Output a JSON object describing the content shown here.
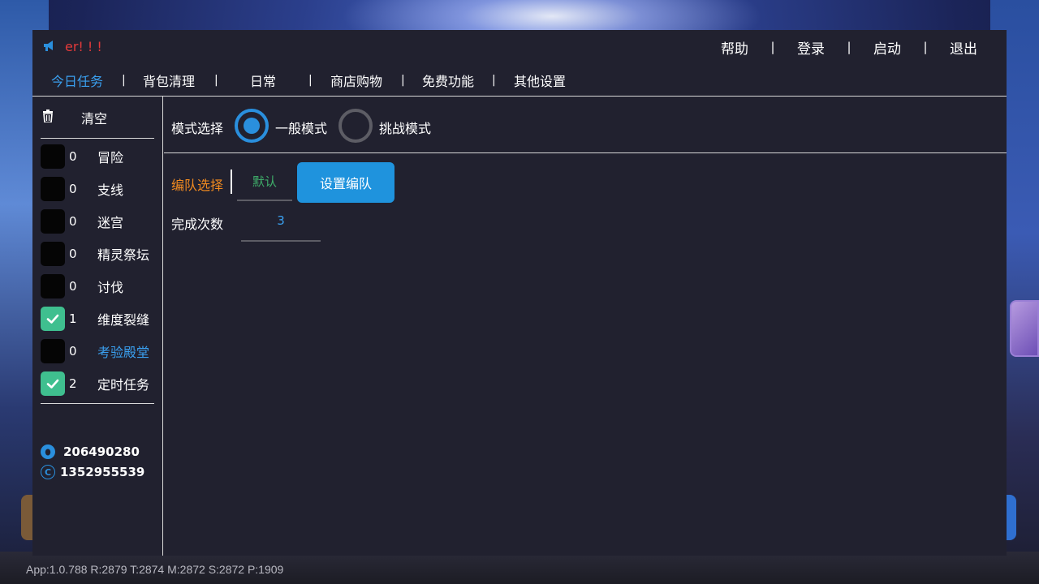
{
  "header": {
    "notice_text": "er! ! !",
    "links": [
      {
        "label": "帮助"
      },
      {
        "label": "登录"
      },
      {
        "label": "启动"
      },
      {
        "label": "退出"
      }
    ],
    "separator": "|"
  },
  "tabs": [
    {
      "label": "今日任务",
      "active": true
    },
    {
      "label": "背包清理"
    },
    {
      "label": "日常"
    },
    {
      "label": "商店购物"
    },
    {
      "label": "免费功能"
    },
    {
      "label": "其他设置"
    }
  ],
  "sidebar": {
    "clear_label": "清空",
    "tasks": [
      {
        "count": "0",
        "label": "冒险",
        "checked": false
      },
      {
        "count": "0",
        "label": "支线",
        "checked": false
      },
      {
        "count": "0",
        "label": "迷宫",
        "checked": false
      },
      {
        "count": "0",
        "label": "精灵祭坛",
        "checked": false
      },
      {
        "count": "0",
        "label": "讨伐",
        "checked": false
      },
      {
        "count": "1",
        "label": "维度裂缝",
        "checked": true
      },
      {
        "count": "0",
        "label": "考验殿堂",
        "checked": false,
        "highlighted": true
      },
      {
        "count": "2",
        "label": "定时任务",
        "checked": true
      }
    ],
    "contacts": [
      {
        "icon": "qq-icon",
        "value": "206490280"
      },
      {
        "icon": "copyright-icon",
        "value": "1352955539"
      }
    ]
  },
  "main": {
    "mode_label": "模式选择",
    "modes": [
      {
        "label": "一般模式",
        "selected": true
      },
      {
        "label": "挑战模式",
        "selected": false
      }
    ],
    "team_label": "编队选择",
    "team_value": "默认",
    "team_button": "设置编队",
    "count_label": "完成次数",
    "count_value": "3"
  },
  "statusbar": {
    "text": "App:1.0.788  R:2879 T:2874 M:2872 S:2872 P:1909"
  },
  "colors": {
    "panel_bg": "#21212f",
    "accent_blue": "#2a8fdd",
    "checked_green": "#3fbf8f",
    "notice_red": "#e23a3a",
    "team_label_orange": "#f08a20",
    "team_value_green": "#3fae6a"
  }
}
